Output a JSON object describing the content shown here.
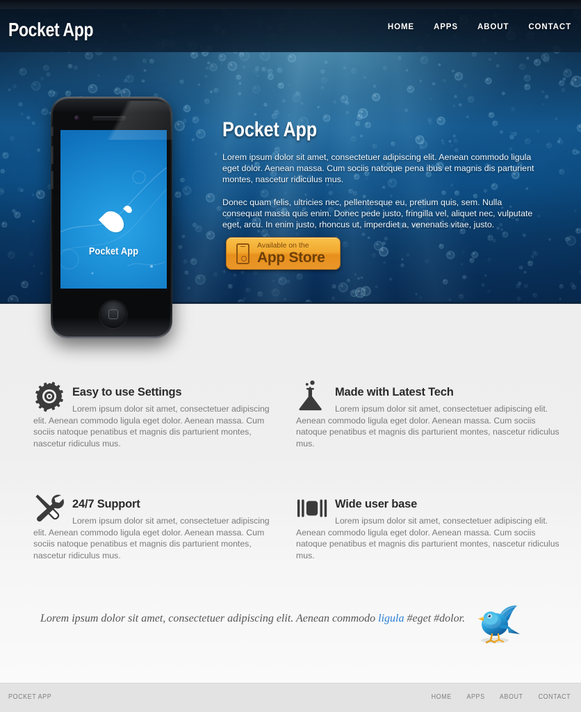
{
  "site": {
    "logo": "Pocket App",
    "nav": [
      {
        "label": "HOME"
      },
      {
        "label": "APPS"
      },
      {
        "label": "ABOUT"
      },
      {
        "label": "CONTACT"
      }
    ]
  },
  "hero": {
    "title": "Pocket App",
    "paragraph1": "Lorem ipsum dolor sit amet, consectetuer adipiscing elit. Aenean commodo ligula eget dolor. Aenean massa. Cum sociis natoque pena ibus et magnis dis parturient montes, nascetur ridiculus mus.",
    "paragraph2": "Donec quam felis, ultricies nec, pellentesque eu, pretium quis, sem. Nulla consequat massa quis enim. Donec pede justo, fringilla vel, aliquet nec, vulputate eget, arcu. In enim justo, rhoncus ut, imperdiet a, venenatis vitae, justo.",
    "appstore": {
      "small_label": "Available on the",
      "big_label": "App Store",
      "icon": "iphone-icon",
      "color": "#f2a92f"
    },
    "phone": {
      "screen_label": "Pocket App",
      "screen_icon": "water-drop-icon",
      "screen_color": "#1b8ed6"
    },
    "background_color": "#13568c"
  },
  "features": [
    {
      "icon": "gear-icon",
      "title": "Easy to use Settings",
      "description": "Lorem ipsum dolor sit amet, consectetuer adipiscing elit. Aenean commodo ligula eget dolor. Aenean massa. Cum sociis natoque penatibus et magnis dis parturient montes, nascetur ridiculus mus."
    },
    {
      "icon": "flask-icon",
      "title": "Made with Latest Tech",
      "description": "Lorem ipsum dolor sit amet, consectetuer adipiscing elit. Aenean commodo ligula eget dolor. Aenean massa. Cum sociis natoque penatibus et magnis dis parturient montes, nascetur ridiculus mus."
    },
    {
      "icon": "wrench-screwdriver-icon",
      "title": "24/7 Support",
      "description": "Lorem ipsum dolor sit amet, consectetuer adipiscing elit. Aenean commodo ligula eget dolor. Aenean massa. Cum sociis natoque penatibus et magnis dis parturient montes, nascetur ridiculus mus."
    },
    {
      "icon": "users-bars-icon",
      "title": "Wide user base",
      "description": "Lorem ipsum dolor sit amet, consectetuer adipiscing elit. Aenean commodo ligula eget dolor. Aenean massa. Cum sociis natoque penatibus et magnis dis parturient montes, nascetur ridiculus mus."
    }
  ],
  "twitter": {
    "text_before": "Lorem ipsum dolor sit amet, consectetuer adipiscing elit. Aenean commodo ",
    "link": "ligula",
    "text_after": " #eget #dolor.",
    "icon": "twitter-bird-icon",
    "link_color": "#2a7fd4"
  },
  "footer": {
    "copyright": "POCKET APP",
    "nav": [
      {
        "label": "HOME"
      },
      {
        "label": "APPS"
      },
      {
        "label": "ABOUT"
      },
      {
        "label": "CONTACT"
      }
    ]
  }
}
